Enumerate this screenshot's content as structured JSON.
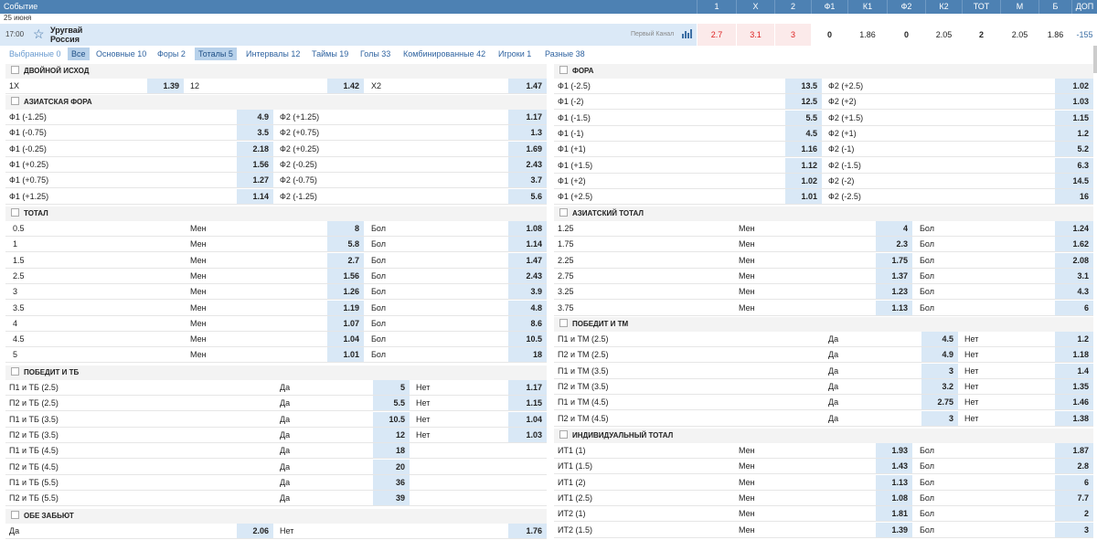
{
  "header": {
    "title": "Событие",
    "columns": [
      "1",
      "X",
      "2",
      "Ф1",
      "К1",
      "Ф2",
      "К2",
      "ТОТ",
      "М",
      "Б",
      "ДОП"
    ]
  },
  "date": "25 июня",
  "event": {
    "time": "17:00",
    "team1": "Уругвай",
    "team2": "Россия",
    "channel": "Первый Канал",
    "odds": [
      "2.7",
      "3.1",
      "3",
      "0",
      "1.86",
      "0",
      "2.05",
      "2",
      "2.05",
      "1.86",
      "-155"
    ]
  },
  "tabs": [
    {
      "label": "Выбранные 0"
    },
    {
      "label": "Все"
    },
    {
      "label": "Основные 10"
    },
    {
      "label": "Форы 2"
    },
    {
      "label": "Тоталы 5"
    },
    {
      "label": "Интервалы 12"
    },
    {
      "label": "Таймы 19"
    },
    {
      "label": "Голы 33"
    },
    {
      "label": "Комбинированные 42"
    },
    {
      "label": "Игроки 1"
    },
    {
      "label": "Разные 38"
    }
  ],
  "left": {
    "double": {
      "title": "ДВОЙНОЙ ИСХОД",
      "row": [
        "1X",
        "1.39",
        "12",
        "1.42",
        "X2",
        "1.47"
      ]
    },
    "asian_hcp": {
      "title": "АЗИАТСКАЯ ФОРА",
      "rows": [
        [
          "Ф1 (-1.25)",
          "4.9",
          "Ф2 (+1.25)",
          "1.17"
        ],
        [
          "Ф1 (-0.75)",
          "3.5",
          "Ф2 (+0.75)",
          "1.3"
        ],
        [
          "Ф1 (-0.25)",
          "2.18",
          "Ф2 (+0.25)",
          "1.69"
        ],
        [
          "Ф1 (+0.25)",
          "1.56",
          "Ф2 (-0.25)",
          "2.43"
        ],
        [
          "Ф1 (+0.75)",
          "1.27",
          "Ф2 (-0.75)",
          "3.7"
        ],
        [
          "Ф1 (+1.25)",
          "1.14",
          "Ф2 (-1.25)",
          "5.6"
        ]
      ]
    },
    "total": {
      "title": "ТОТАЛ",
      "rows": [
        [
          "0.5",
          "Мен",
          "8",
          "Бол",
          "1.08"
        ],
        [
          "1",
          "Мен",
          "5.8",
          "Бол",
          "1.14"
        ],
        [
          "1.5",
          "Мен",
          "2.7",
          "Бол",
          "1.47"
        ],
        [
          "2.5",
          "Мен",
          "1.56",
          "Бол",
          "2.43"
        ],
        [
          "3",
          "Мен",
          "1.26",
          "Бол",
          "3.9"
        ],
        [
          "3.5",
          "Мен",
          "1.19",
          "Бол",
          "4.8"
        ],
        [
          "4",
          "Мен",
          "1.07",
          "Бол",
          "8.6"
        ],
        [
          "4.5",
          "Мен",
          "1.04",
          "Бол",
          "10.5"
        ],
        [
          "5",
          "Мен",
          "1.01",
          "Бол",
          "18"
        ]
      ]
    },
    "win_tb": {
      "title": "ПОБЕДИТ И ТБ",
      "rows": [
        [
          "П1 и ТБ  (2.5)",
          "Да",
          "5",
          "Нет",
          "1.17"
        ],
        [
          "П2 и ТБ  (2.5)",
          "Да",
          "5.5",
          "Нет",
          "1.15"
        ],
        [
          "П1 и ТБ  (3.5)",
          "Да",
          "10.5",
          "Нет",
          "1.04"
        ],
        [
          "П2 и ТБ  (3.5)",
          "Да",
          "12",
          "Нет",
          "1.03"
        ],
        [
          "П1 и ТБ  (4.5)",
          "Да",
          "18",
          "",
          ""
        ],
        [
          "П2 и ТБ  (4.5)",
          "Да",
          "20",
          "",
          ""
        ],
        [
          "П1 и ТБ  (5.5)",
          "Да",
          "36",
          "",
          ""
        ],
        [
          "П2 и ТБ  (5.5)",
          "Да",
          "39",
          "",
          ""
        ]
      ]
    },
    "both": {
      "title": "ОБЕ ЗАБЬЮТ",
      "row": [
        "Да",
        "2.06",
        "Нет",
        "1.76"
      ]
    }
  },
  "right": {
    "fora": {
      "title": "ФОРА",
      "rows": [
        [
          "Ф1 (-2.5)",
          "13.5",
          "Ф2 (+2.5)",
          "1.02"
        ],
        [
          "Ф1 (-2)",
          "12.5",
          "Ф2 (+2)",
          "1.03"
        ],
        [
          "Ф1 (-1.5)",
          "5.5",
          "Ф2 (+1.5)",
          "1.15"
        ],
        [
          "Ф1 (-1)",
          "4.5",
          "Ф2 (+1)",
          "1.2"
        ],
        [
          "Ф1 (+1)",
          "1.16",
          "Ф2 (-1)",
          "5.2"
        ],
        [
          "Ф1 (+1.5)",
          "1.12",
          "Ф2 (-1.5)",
          "6.3"
        ],
        [
          "Ф1 (+2)",
          "1.02",
          "Ф2 (-2)",
          "14.5"
        ],
        [
          "Ф1 (+2.5)",
          "1.01",
          "Ф2 (-2.5)",
          "16"
        ]
      ]
    },
    "asian_total": {
      "title": "АЗИАТСКИЙ ТОТАЛ",
      "rows": [
        [
          "1.25",
          "Мен",
          "4",
          "Бол",
          "1.24"
        ],
        [
          "1.75",
          "Мен",
          "2.3",
          "Бол",
          "1.62"
        ],
        [
          "2.25",
          "Мен",
          "1.75",
          "Бол",
          "2.08"
        ],
        [
          "2.75",
          "Мен",
          "1.37",
          "Бол",
          "3.1"
        ],
        [
          "3.25",
          "Мен",
          "1.23",
          "Бол",
          "4.3"
        ],
        [
          "3.75",
          "Мен",
          "1.13",
          "Бол",
          "6"
        ]
      ]
    },
    "win_tm": {
      "title": "ПОБЕДИТ И ТМ",
      "rows": [
        [
          "П1 и ТМ  (2.5)",
          "Да",
          "4.5",
          "Нет",
          "1.2"
        ],
        [
          "П2 и ТМ  (2.5)",
          "Да",
          "4.9",
          "Нет",
          "1.18"
        ],
        [
          "П1 и ТМ  (3.5)",
          "Да",
          "3",
          "Нет",
          "1.4"
        ],
        [
          "П2 и ТМ  (3.5)",
          "Да",
          "3.2",
          "Нет",
          "1.35"
        ],
        [
          "П1 и ТМ  (4.5)",
          "Да",
          "2.75",
          "Нет",
          "1.46"
        ],
        [
          "П2 и ТМ  (4.5)",
          "Да",
          "3",
          "Нет",
          "1.38"
        ]
      ]
    },
    "ind_total": {
      "title": "ИНДИВИДУАЛЬНЫЙ ТОТАЛ",
      "rows": [
        [
          "ИТ1 (1)",
          "Мен",
          "1.93",
          "Бол",
          "1.87"
        ],
        [
          "ИТ1 (1.5)",
          "Мен",
          "1.43",
          "Бол",
          "2.8"
        ],
        [
          "ИТ1 (2)",
          "Мен",
          "1.13",
          "Бол",
          "6"
        ],
        [
          "ИТ1 (2.5)",
          "Мен",
          "1.08",
          "Бол",
          "7.7"
        ],
        [
          "ИТ2 (1)",
          "Мен",
          "1.81",
          "Бол",
          "2"
        ],
        [
          "ИТ2 (1.5)",
          "Мен",
          "1.39",
          "Бол",
          "3"
        ]
      ]
    }
  }
}
